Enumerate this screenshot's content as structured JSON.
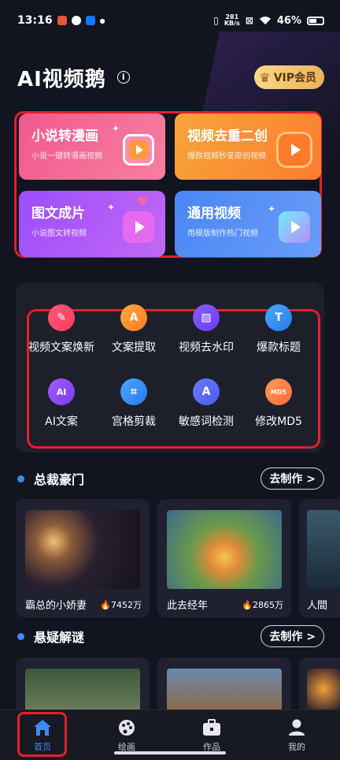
{
  "status_bar": {
    "time": "13:16",
    "net_speed_value": "281",
    "net_speed_unit": "KB/s",
    "battery": "46%"
  },
  "header": {
    "app_title": "AI视频鹅",
    "info_icon": "info-icon",
    "vip_label": "VIP会员"
  },
  "feature_cards": [
    {
      "title": "小说转漫画",
      "subtitle": "小说一键转漫画视频"
    },
    {
      "title": "视频去重二创",
      "subtitle": "爆款视频秒变原创视频"
    },
    {
      "title": "图文成片",
      "subtitle": "小说图文转视频"
    },
    {
      "title": "通用视频",
      "subtitle": "用模版制作热门视频"
    }
  ],
  "tools": [
    {
      "label": "视频文案焕新",
      "icon": "pen-icon"
    },
    {
      "label": "文案提取",
      "icon": "text-extract-icon",
      "glyph": "A"
    },
    {
      "label": "视频去水印",
      "icon": "image-icon"
    },
    {
      "label": "爆款标题",
      "icon": "title-icon",
      "glyph": "T"
    },
    {
      "label": "AI文案",
      "icon": "ai-doc-icon",
      "glyph": "AI"
    },
    {
      "label": "宫格剪裁",
      "icon": "crop-icon"
    },
    {
      "label": "敏感词检测",
      "icon": "doc-check-icon",
      "glyph": "A"
    },
    {
      "label": "修改MD5",
      "icon": "md5-icon",
      "glyph": "MD5"
    }
  ],
  "sections": [
    {
      "title": "总裁豪门",
      "action": "去制作 >",
      "items": [
        {
          "name": "霸总的小娇妻",
          "heat": "7452万"
        },
        {
          "name": "此去经年",
          "heat": "2865万"
        },
        {
          "name": "人間",
          "heat": ""
        }
      ]
    },
    {
      "title": "悬疑解谜",
      "action": "去制作 >"
    }
  ],
  "tab_bar": [
    {
      "label": "首页",
      "icon": "home-icon",
      "active": true
    },
    {
      "label": "绘画",
      "icon": "palette-icon",
      "active": false
    },
    {
      "label": "作品",
      "icon": "briefcase-icon",
      "active": false
    },
    {
      "label": "我的",
      "icon": "user-icon",
      "active": false
    }
  ],
  "colors": {
    "background": "#121420",
    "accent": "#3b8cf3",
    "highlight_box": "#e4202a",
    "vip_gold": "#eab35a"
  }
}
